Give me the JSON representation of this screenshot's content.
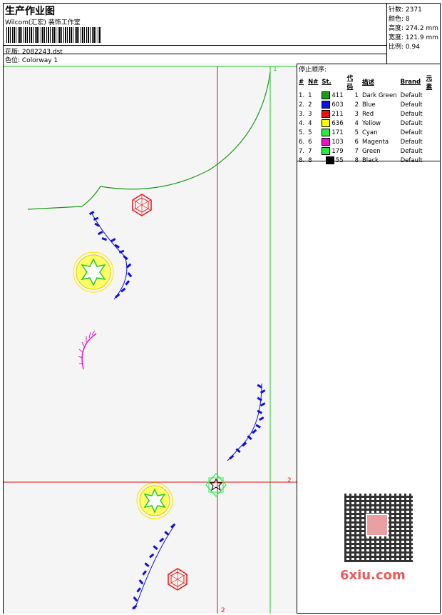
{
  "header": {
    "title": "生产作业图",
    "studio": "Wilcom(汇宏) 装饰工作室",
    "design_label": "花版: 2082243.dst",
    "colorway_label": "色位: Colorway 1"
  },
  "stats": [
    {
      "text": "针数: 2371"
    },
    {
      "text": "颜色: 8"
    },
    {
      "text": "高度: 274.2 mm"
    },
    {
      "text": "宽度: 121.9 mm"
    },
    {
      "text": "比例: 0.94"
    }
  ],
  "stop_sequence": {
    "title": "停止顺序:",
    "headers": [
      "#",
      "N#",
      "St.",
      "代码",
      "描述",
      "Brand",
      "元素"
    ],
    "rows": [
      {
        "idx": "1.",
        "n": "1",
        "color": "#1a9b1a",
        "st": "411",
        "code": "1",
        "desc": "Dark Green",
        "brand": "Default"
      },
      {
        "idx": "2.",
        "n": "2",
        "color": "#1010e0",
        "st": "603",
        "code": "2",
        "desc": "Blue",
        "brand": "Default"
      },
      {
        "idx": "3.",
        "n": "3",
        "color": "#ee1111",
        "st": "211",
        "code": "3",
        "desc": "Red",
        "brand": "Default"
      },
      {
        "idx": "4.",
        "n": "4",
        "color": "#ffff00",
        "st": "636",
        "code": "4",
        "desc": "Yellow",
        "brand": "Default"
      },
      {
        "idx": "5.",
        "n": "5",
        "color": "#22ee44",
        "st": "171",
        "code": "5",
        "desc": "Cyan",
        "brand": "Default"
      },
      {
        "idx": "6.",
        "n": "6",
        "color": "#ee11cc",
        "st": "103",
        "code": "6",
        "desc": "Magenta",
        "brand": "Default"
      },
      {
        "idx": "7.",
        "n": "7",
        "color": "#22ee44",
        "st": "179",
        "code": "7",
        "desc": "Green",
        "brand": "Default"
      },
      {
        "idx": "8.",
        "n": "8",
        "color": "#000000",
        "st": "55",
        "code": "8",
        "desc": "Black",
        "brand": "Default"
      }
    ]
  },
  "canvas": {
    "marker_1": "1",
    "marker_2_right": "2",
    "marker_2_bottom": "2",
    "colors": {
      "green_line": "#22cc22",
      "red_line": "#dd1111",
      "blue": "#1010e0",
      "yellow": "#ffff00",
      "magenta": "#ee11cc",
      "dark_green": "#1a9b1a"
    }
  },
  "watermark": {
    "text": "6xiu.com"
  }
}
